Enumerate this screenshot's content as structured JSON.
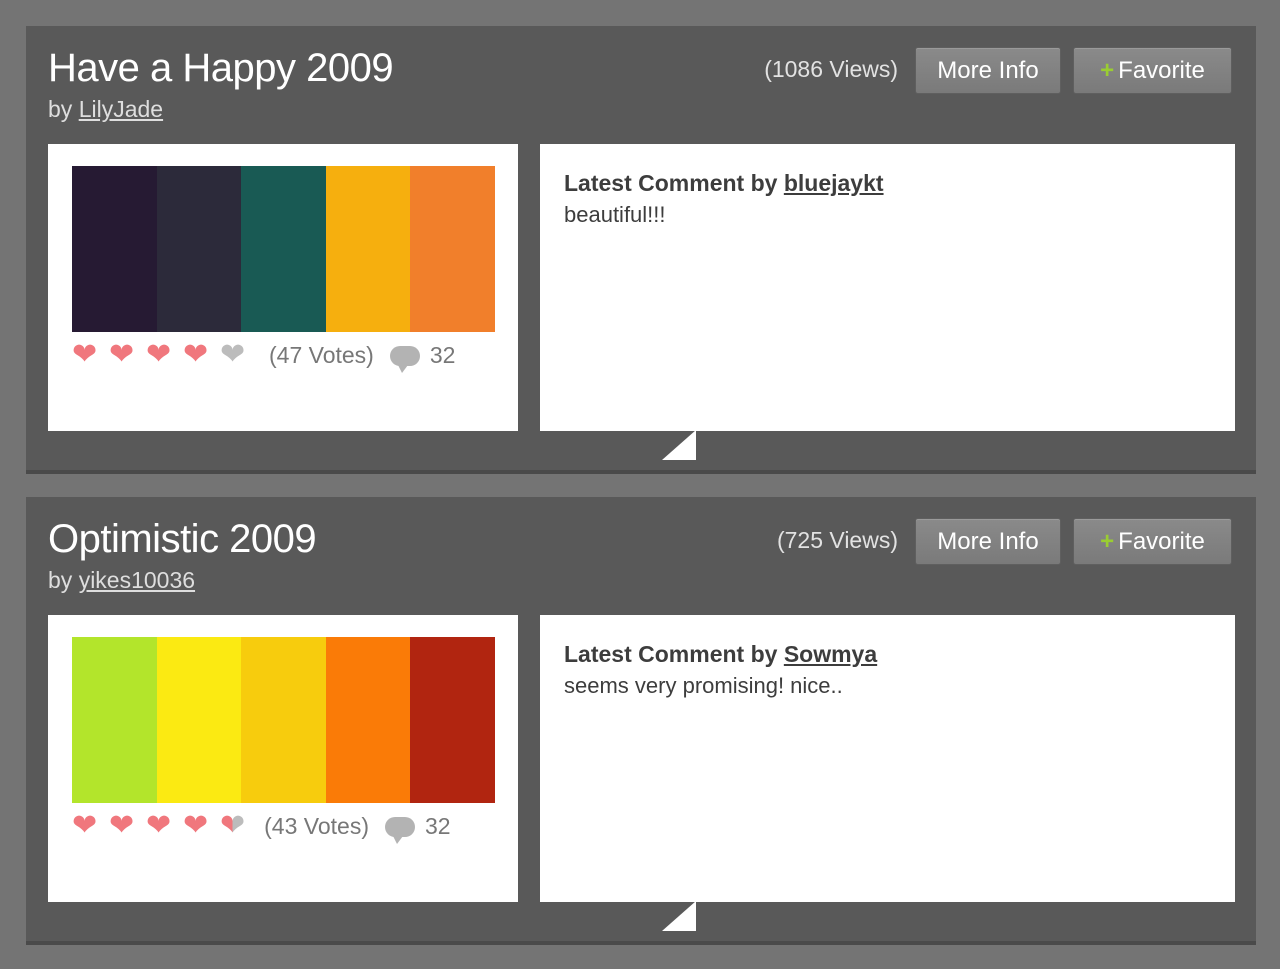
{
  "palettes": [
    {
      "title": "Have a Happy 2009",
      "by_prefix": "by",
      "author": "LilyJade",
      "views": "(1086 Views)",
      "more_info_label": "More Info",
      "favorite_label": "Favorite",
      "favorite_plus": "+",
      "colors": [
        "#261a33",
        "#2c2a3a",
        "#195a54",
        "#f6af0e",
        "#f17f2b"
      ],
      "rating_hearts": 4,
      "rating_max": 5,
      "votes": "(47 Votes)",
      "comment_count": "32",
      "comment_prefix": "Latest Comment by",
      "comment_author": "bluejaykt",
      "comment_text": "beautiful!!!"
    },
    {
      "title": "Optimistic 2009",
      "by_prefix": "by",
      "author": "yikes10036",
      "views": "(725 Views)",
      "more_info_label": "More Info",
      "favorite_label": "Favorite",
      "favorite_plus": "+",
      "colors": [
        "#b3e52b",
        "#fbea12",
        "#f7cc0d",
        "#fa7b07",
        "#b12510"
      ],
      "rating_hearts": 4.5,
      "rating_max": 5,
      "votes": "(43 Votes)",
      "comment_count": "32",
      "comment_prefix": "Latest Comment by",
      "comment_author": "Sowmya",
      "comment_text": "seems very promising! nice.."
    }
  ],
  "icons": {
    "heart": "heart-icon",
    "comment": "comment-bubble-icon",
    "plus": "plus-icon"
  },
  "colors": {
    "heart_on": "#f0777d",
    "heart_off": "#bcbcbc",
    "accent_plus": "#9acd32"
  }
}
